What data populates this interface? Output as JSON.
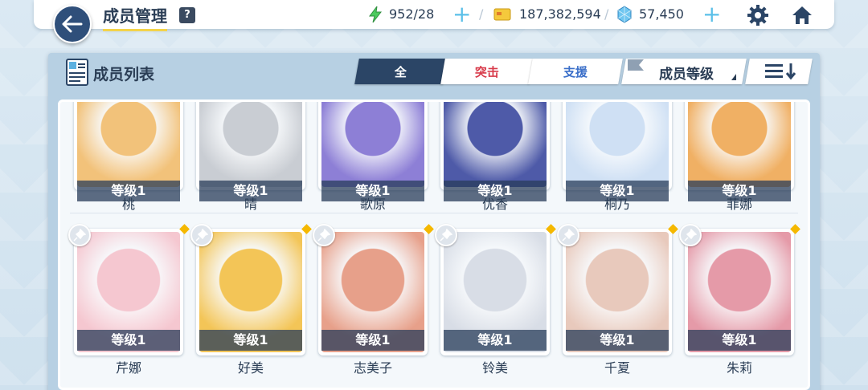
{
  "header": {
    "title": "成员管理",
    "help": "?",
    "ap": "952/28",
    "credits": "187,382,594",
    "pyroxene": "57,450",
    "add_symbol": "+",
    "separator": "/"
  },
  "panel": {
    "title": "成员列表",
    "tabs": [
      {
        "label": "全",
        "active": true
      },
      {
        "label": "突击",
        "active": false
      },
      {
        "label": "支援",
        "active": false
      }
    ],
    "sort_label": "成员等级"
  },
  "students_row1": [
    {
      "name": "桃",
      "level": "等级1",
      "bg": "#f2c27a"
    },
    {
      "name": "晴",
      "level": "等级1",
      "bg": "#c9cdd3"
    },
    {
      "name": "歌原",
      "level": "等级1",
      "bg": "#8d7fd6"
    },
    {
      "name": "优香",
      "level": "等级1",
      "bg": "#4e5aa8"
    },
    {
      "name": "桐乃",
      "level": "等级1",
      "bg": "#cfe0f4"
    },
    {
      "name": "菲娜",
      "level": "等级1",
      "bg": "#f0b064"
    }
  ],
  "students_row2": [
    {
      "name": "芹娜",
      "level": "等级1",
      "bg": "#f5c7d0"
    },
    {
      "name": "好美",
      "level": "等级1",
      "bg": "#f3c557"
    },
    {
      "name": "志美子",
      "level": "等级1",
      "bg": "#e7a08a"
    },
    {
      "name": "铃美",
      "level": "等级1",
      "bg": "#d8dde6"
    },
    {
      "name": "千夏",
      "level": "等级1",
      "bg": "#e8c9bc"
    },
    {
      "name": "朱莉",
      "level": "等级1",
      "bg": "#e59aa8"
    }
  ],
  "colors": {
    "accent": "#2b4566",
    "strike": "#d83a4a",
    "support": "#3b6fc9",
    "new_marker": "#f5b800"
  }
}
